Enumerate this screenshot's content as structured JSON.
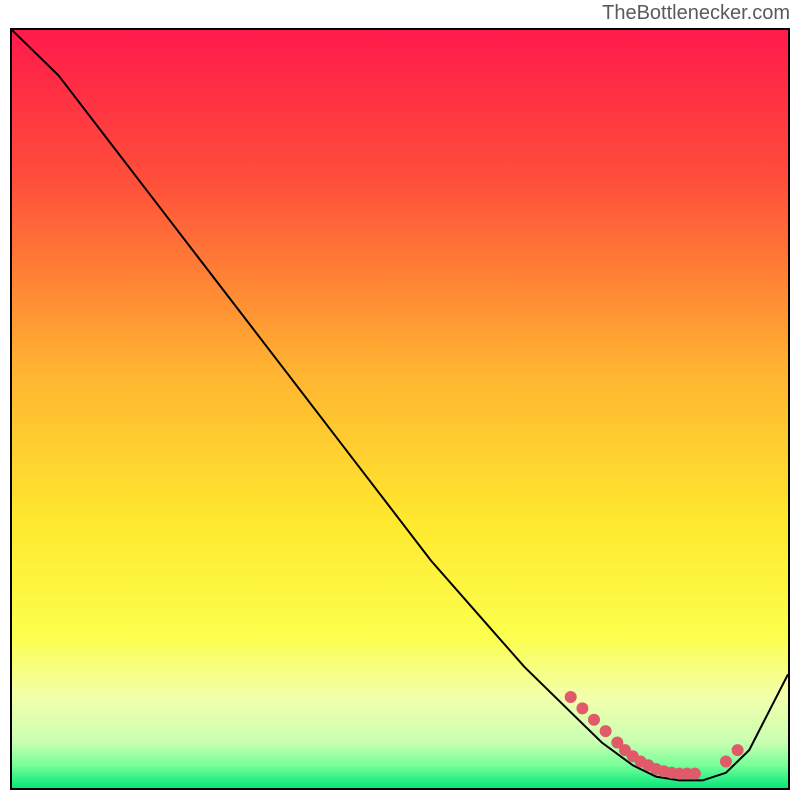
{
  "attribution": "TheBottlenecker.com",
  "chart_data": {
    "type": "line",
    "title": "",
    "xlabel": "",
    "ylabel": "",
    "xlim": [
      0,
      100
    ],
    "ylim": [
      0,
      100
    ],
    "background_gradient": {
      "stops": [
        {
          "offset": 0,
          "color": "#ff1a4b"
        },
        {
          "offset": 20,
          "color": "#ff4f3a"
        },
        {
          "offset": 45,
          "color": "#ffb431"
        },
        {
          "offset": 65,
          "color": "#ffe92e"
        },
        {
          "offset": 80,
          "color": "#fbff4e"
        },
        {
          "offset": 88,
          "color": "#f3ffac"
        },
        {
          "offset": 94,
          "color": "#c8ffb1"
        },
        {
          "offset": 97,
          "color": "#77ff9a"
        },
        {
          "offset": 100,
          "color": "#06e57a"
        }
      ]
    },
    "series": [
      {
        "name": "bottleneck-curve",
        "x": [
          0,
          6,
          12,
          18,
          24,
          30,
          36,
          42,
          48,
          54,
          60,
          66,
          72,
          76,
          80,
          83,
          86,
          89,
          92,
          95,
          97,
          100
        ],
        "y": [
          100,
          94,
          86,
          78,
          70,
          62,
          54,
          46,
          38,
          30,
          23,
          16,
          10,
          6,
          3,
          1.5,
          1,
          1,
          2,
          5,
          9,
          15
        ]
      }
    ],
    "markers": {
      "name": "highlight-dots",
      "color": "#e05a6a",
      "x": [
        72,
        73.5,
        75,
        76.5,
        78,
        79,
        80,
        81,
        82,
        83,
        84,
        85,
        86,
        87,
        88,
        92,
        93.5
      ],
      "y": [
        12,
        10.5,
        9,
        7.5,
        6,
        5,
        4.2,
        3.5,
        3,
        2.5,
        2.2,
        2,
        1.9,
        1.9,
        1.9,
        3.5,
        5
      ]
    }
  }
}
